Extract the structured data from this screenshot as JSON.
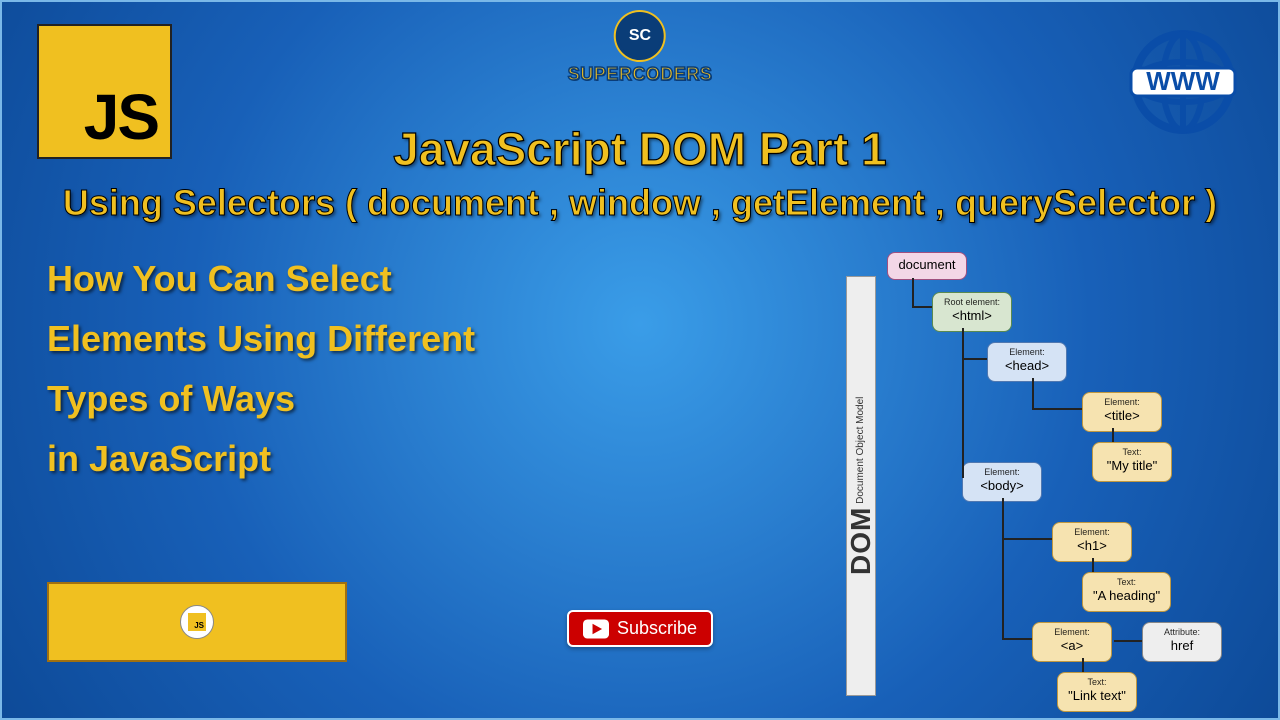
{
  "logo_text": "JS",
  "brand": {
    "circle": "SC",
    "name": "SUPERCODERS"
  },
  "www_label": "WWW",
  "title_line1": "JavaScript  DOM Part 1",
  "title_line2": "Using Selectors ( document , window , getElement , querySelector )",
  "description": [
    "How You Can Select",
    "Elements Using Different",
    "Types of Ways",
    "in JavaScript"
  ],
  "banner_tag": "JS",
  "subscribe_label": "Subscribe",
  "dom_spine": {
    "big": "DOM",
    "small": "Document Object Model"
  },
  "tree": {
    "document": {
      "val": "document"
    },
    "html": {
      "lbl": "Root element:",
      "val": "<html>"
    },
    "head": {
      "lbl": "Element:",
      "val": "<head>"
    },
    "title": {
      "lbl": "Element:",
      "val": "<title>"
    },
    "title_text": {
      "lbl": "Text:",
      "val": "\"My title\""
    },
    "body": {
      "lbl": "Element:",
      "val": "<body>"
    },
    "h1": {
      "lbl": "Element:",
      "val": "<h1>"
    },
    "h1_text": {
      "lbl": "Text:",
      "val": "\"A heading\""
    },
    "a": {
      "lbl": "Element:",
      "val": "<a>"
    },
    "a_attr": {
      "lbl": "Attribute:",
      "val": "href"
    },
    "a_text": {
      "lbl": "Text:",
      "val": "\"Link text\""
    }
  }
}
